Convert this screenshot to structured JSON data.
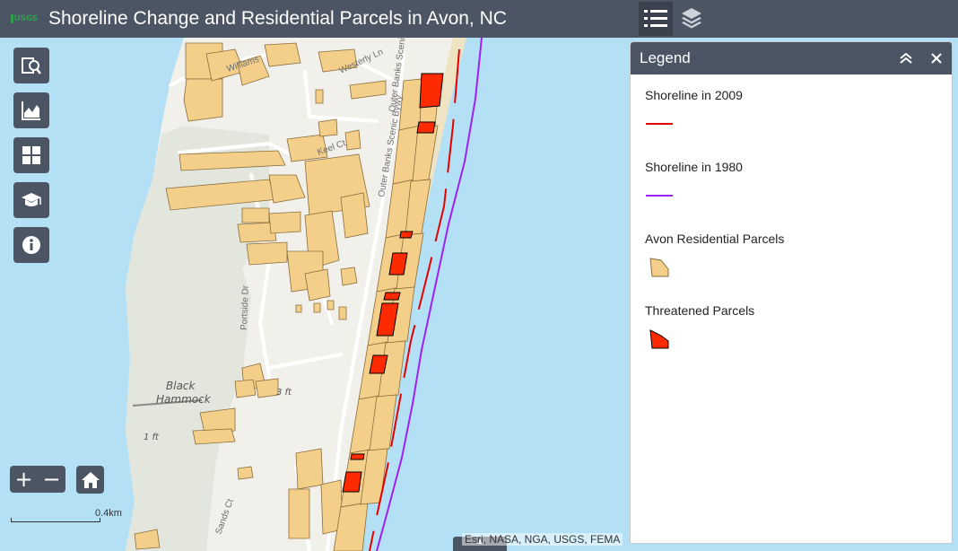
{
  "header": {
    "logo_text": "USGS",
    "title": "Shoreline Change and Residential Parcels in Avon, NC"
  },
  "map": {
    "labels": {
      "williams": "Williams",
      "westerly": "Westerly Ln",
      "byway_top": "Outer Banks Scenic Bywy",
      "byway_mid": "Outer Banks Scenic Bywy",
      "keel": "Keel Ct",
      "portside": "Portside Dr",
      "black": "Black",
      "hammock": "Hammock",
      "elev_3": "3 ft",
      "elev_1": "1 ft",
      "sands": "Sands Ct"
    },
    "scale_label": "0.4km",
    "attribution": "Esri, NASA, NGA, USGS, FEMA",
    "colors": {
      "water": "#b3e0f5",
      "land": "#f2f0ea",
      "marsh": "#e3e6dc",
      "parcel": "#f4cf8a",
      "threatened": "#ff2a00",
      "shore_2009": "#e60000",
      "shore_1980": "#a020f0"
    }
  },
  "widgets": {
    "icons": [
      "query-icon",
      "chart-icon",
      "grid-icon",
      "graduation-cap-icon",
      "info-icon"
    ],
    "zoom_in": "+",
    "zoom_out": "−"
  },
  "legend": {
    "title": "Legend",
    "items": [
      {
        "label": "Shoreline in 2009",
        "symbol": "line",
        "color": "#e60000"
      },
      {
        "label": "Shoreline in 1980",
        "symbol": "line",
        "color": "#a020f0"
      },
      {
        "label": "Avon Residential Parcels",
        "symbol": "polygon",
        "color": "#f4cf8a"
      },
      {
        "label": "Threatened Parcels",
        "symbol": "polygon",
        "color": "#ff2a00"
      }
    ]
  }
}
